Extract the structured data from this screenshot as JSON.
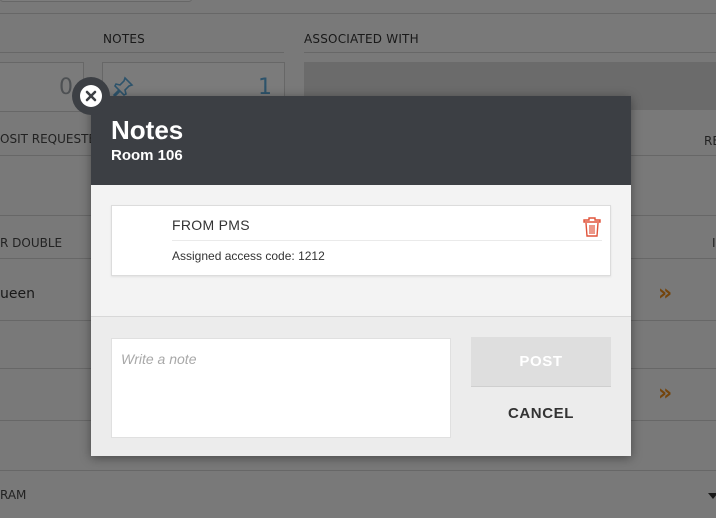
{
  "background": {
    "columns": {
      "notes": "NOTES",
      "associated_with": "ASSOCIATED WITH",
      "deposit_requested": "OSIT REQUESTE",
      "right_header_partial": "RE"
    },
    "counts": {
      "left": "0",
      "notes": "1"
    },
    "room_type_partial": "R DOUBLE",
    "right_col_partial": "I",
    "row_text_partial": "ueen",
    "bottom_label_partial": "RAM",
    "accent_color": "#e88a1a",
    "count_color": "#5aa6d6"
  },
  "modal": {
    "title": "Notes",
    "subtitle": "Room 106",
    "notes": [
      {
        "source": "FROM PMS",
        "text": "Assigned access code: 1212"
      }
    ],
    "input": {
      "placeholder": "Write a note",
      "value": ""
    },
    "post_label": "POST",
    "cancel_label": "CANCEL",
    "header_color": "#3c3f44",
    "delete_color": "#e0533a"
  },
  "icons": {
    "close": "close-icon",
    "delete": "trash-icon",
    "pin": "pin-icon",
    "chevrons": "double-chevron-right-icon",
    "caret": "caret-down-icon"
  }
}
